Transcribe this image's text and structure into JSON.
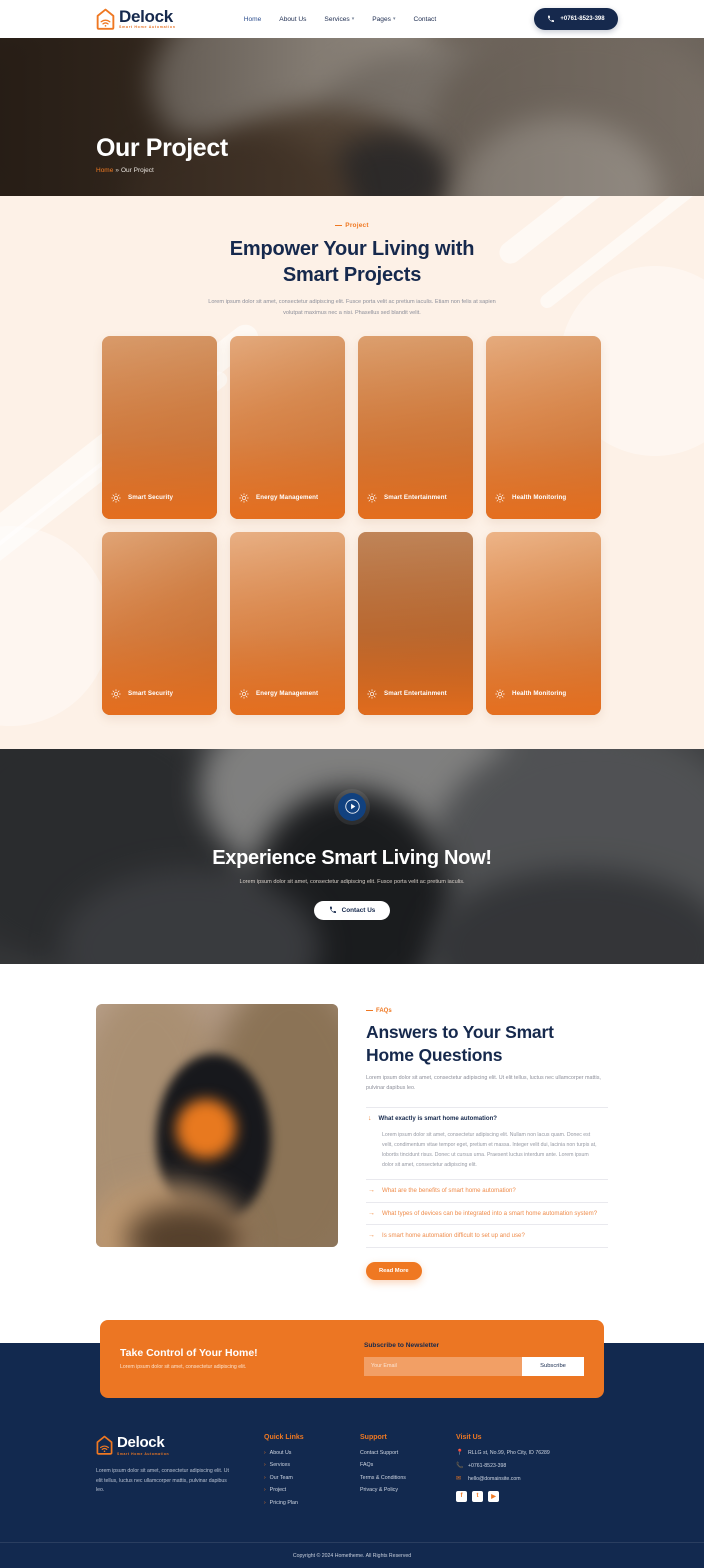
{
  "header": {
    "logo": {
      "title": "Delock",
      "tagline": "Smart Home Automation"
    },
    "nav": [
      {
        "label": "Home",
        "has_dropdown": false
      },
      {
        "label": "About Us",
        "has_dropdown": false
      },
      {
        "label": "Services",
        "has_dropdown": true
      },
      {
        "label": "Pages",
        "has_dropdown": true
      },
      {
        "label": "Contact",
        "has_dropdown": false
      }
    ],
    "phone_button": {
      "label": "+0761-8523-398",
      "icon": "phone-icon"
    }
  },
  "hero": {
    "title": "Our Project",
    "breadcrumb": {
      "home": "Home",
      "separator": "»",
      "current": "Our Project"
    }
  },
  "projects": {
    "eyebrow": "Project",
    "title_line1": "Empower Your Living with",
    "title_line2": "Smart Projects",
    "description": "Lorem ipsum dolor sit amet, consectetur adipiscing elit. Fusce porta velit ac pretium iaculis. Etiam non felis at sapien volutpat maximus nec a nisi. Phasellus sed blandit velit.",
    "cards": [
      {
        "label": "Smart Security",
        "icon": "sun-icon"
      },
      {
        "label": "Energy Management",
        "icon": "sun-icon"
      },
      {
        "label": "Smart Entertainment",
        "icon": "sun-icon"
      },
      {
        "label": "Health Monitoring",
        "icon": "sun-icon"
      },
      {
        "label": "Smart Security",
        "icon": "sun-icon"
      },
      {
        "label": "Energy Management",
        "icon": "sun-icon"
      },
      {
        "label": "Smart Entertainment",
        "icon": "sun-icon"
      },
      {
        "label": "Health Monitoring",
        "icon": "sun-icon"
      }
    ]
  },
  "band": {
    "title": "Experience Smart Living Now!",
    "description": "Lorem ipsum dolor sit amet, consectetur adipiscing elit. Fusce porta velit ac pretium iaculis.",
    "button_label": "Contact Us",
    "play_icon": "play-icon"
  },
  "faq": {
    "eyebrow": "FAQs",
    "title_line1": "Answers to Your Smart",
    "title_line2": "Home Questions",
    "description": "Lorem ipsum dolor sit amet, consectetur adipiscing elit. Ut elit tellus, luctus nec ullamcorper mattis, pulvinar dapibus leo.",
    "items": [
      {
        "question": "What exactly is smart home automation?",
        "answer": "Lorem ipsum dolor sit amet, consectetur adipiscing elit. Nullam non lacus quam. Donec est velit, condimentum vitae tempor eget, pretium et massa. Integer velit dui, lacinia non turpis at, lobortis tincidunt risus. Donec ut cursus urna. Praesent luctus interdum ante. Lorem ipsum dolor sit amet, consectetur adipiscing elit.",
        "open": true
      },
      {
        "question": "What are the benefits of smart home automation?",
        "answer": "",
        "open": false
      },
      {
        "question": "What types of devices can be integrated into a smart home automation system?",
        "answer": "",
        "open": false
      },
      {
        "question": "Is smart home automation difficult to set up and use?",
        "answer": "",
        "open": false
      }
    ],
    "read_more_label": "Read More"
  },
  "newsletter": {
    "title": "Take Control of Your Home!",
    "subtitle": "Lorem ipsum dolor sit amet, consectetur adipiscing elit.",
    "form_label": "Subscribe to Newsletter",
    "input_placeholder": "Your Email",
    "input_value": "",
    "button_label": "Subscribe"
  },
  "footer": {
    "logo": {
      "title": "Delock",
      "tagline": "Smart Home Automation"
    },
    "about": "Lorem ipsum dolor sit amet, consectetur adipiscing elit. Ut elit tellus, luctus nec ullamcorper mattis, pulvinar dapibus leo.",
    "quick_links": {
      "heading": "Quick Links",
      "items": [
        "About Us",
        "Services",
        "Our Team",
        "Project",
        "Pricing Plan"
      ]
    },
    "support": {
      "heading": "Support",
      "items": [
        "Contact Support",
        "FAQs",
        "Terms & Conditions",
        "Privacy & Policy"
      ]
    },
    "visit": {
      "heading": "Visit Us",
      "address": "RLLG st, No.99, Pho City, ID 76289",
      "phone": "+0761-8523-398",
      "email": "hello@domainsite.com",
      "icons": {
        "address": "location-pin-icon",
        "phone": "phone-icon",
        "email": "envelope-icon"
      },
      "socials": [
        {
          "name": "facebook-icon",
          "glyph": "f"
        },
        {
          "name": "twitter-icon",
          "glyph": "t"
        },
        {
          "name": "youtube-icon",
          "glyph": "▶"
        }
      ]
    },
    "copyright": "Copyright © 2024 Hometheme. All Rights Reserved"
  },
  "colors": {
    "primary_navy": "#16294d",
    "accent_orange": "#ef7822",
    "cream": "#fdf1e7",
    "footer_navy": "#12294f"
  }
}
